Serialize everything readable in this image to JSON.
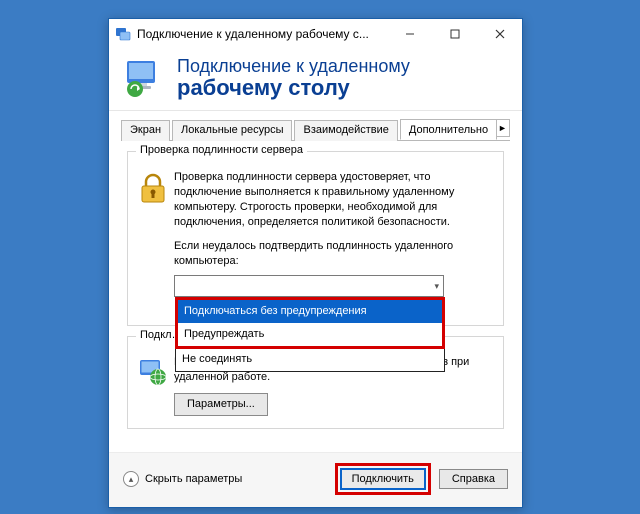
{
  "window": {
    "title": "Подключение к удаленному рабочему с..."
  },
  "banner": {
    "line1": "Подключение к удаленному",
    "line2": "рабочему столу"
  },
  "tabs": {
    "t0": "Экран",
    "t1": "Локальные ресурсы",
    "t2": "Взаимодействие",
    "t3": "Дополнительно"
  },
  "group_auth": {
    "legend": "Проверка подлинности сервера",
    "desc": "Проверка подлинности сервера удостоверяет, что подключение выполняется к правильному удаленному компьютеру. Строгость проверки, необходимой для подключения, определяется политикой безопасности.",
    "sub": "Если неудалось подтвердить подлинность удаленного компьютера:",
    "combo_value": "",
    "options": {
      "o0": "Подключаться без предупреждения",
      "o1": "Предупреждать",
      "o2": "Не соединять"
    }
  },
  "group_conn": {
    "legend": "Подкл…",
    "desc": "Настройка параметров для подключения через шлюз при удаленной работе.",
    "button": "Параметры..."
  },
  "footer": {
    "collapse": "Скрыть параметры",
    "connect": "Подключить",
    "help": "Справка"
  }
}
